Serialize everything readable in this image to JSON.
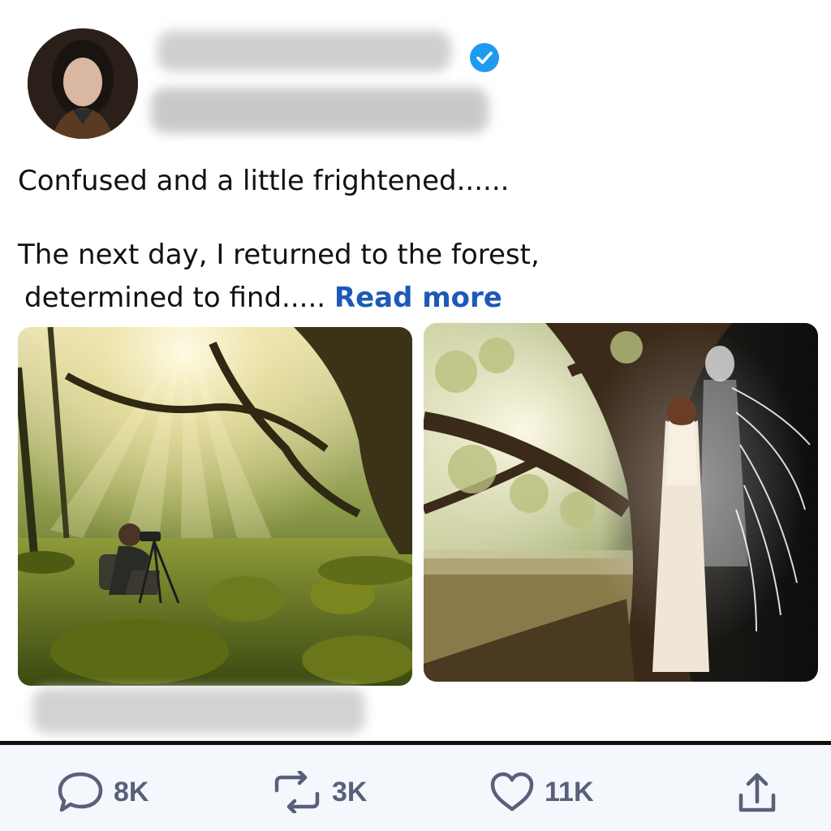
{
  "post": {
    "line1": "Confused and a little frightened......",
    "line2": "The next day, I returned to the forest,",
    "line3": "determined to find.....",
    "read_more": "Read more"
  },
  "images": [
    {
      "subject": "photographer in sunlit forest"
    },
    {
      "subject": "woman with glowing spirit under oak"
    }
  ],
  "actions": {
    "replies": "8K",
    "reposts": "3K",
    "likes": "11K"
  },
  "colors": {
    "link": "#1d59b7",
    "verified": "#1d9bf0",
    "action": "#58607a"
  },
  "icons": [
    "verified-badge-icon",
    "reply-icon",
    "repost-icon",
    "like-icon",
    "share-icon"
  ]
}
